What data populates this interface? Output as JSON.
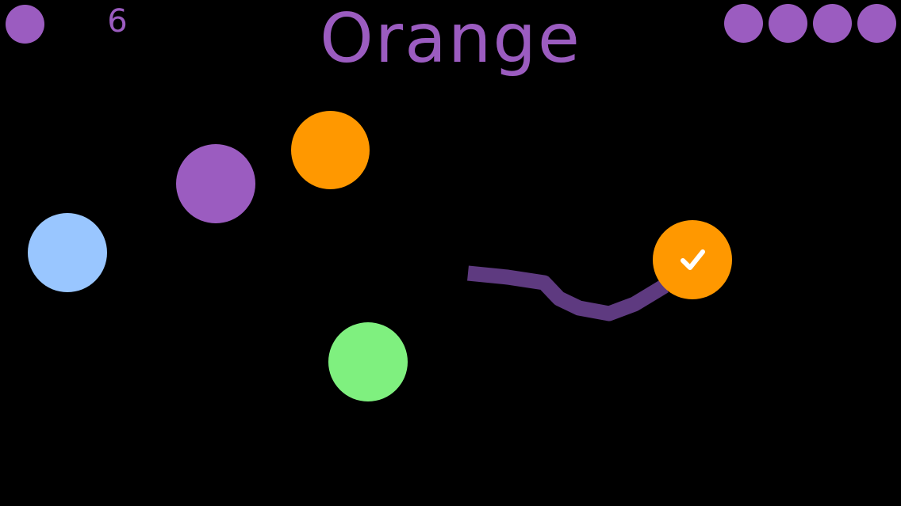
{
  "hud": {
    "score": "6",
    "target_word": "Orange",
    "lives_remaining": 4
  },
  "colors": {
    "background": "#000000",
    "hud": "#9b5cc0",
    "trail": "#5e3a80",
    "purple": "#9b5cc0",
    "orange": "#ff9800",
    "light_blue": "#99c6ff",
    "green": "#7ff07f",
    "check": "#ffffff"
  },
  "balls": [
    {
      "name": "ball-orange-top",
      "color": "orange"
    },
    {
      "name": "ball-purple",
      "color": "purple"
    },
    {
      "name": "ball-light-blue",
      "color": "light_blue"
    },
    {
      "name": "ball-green",
      "color": "green"
    },
    {
      "name": "ball-orange-selected",
      "color": "orange",
      "selected": true,
      "icon": "checkmark-icon"
    }
  ]
}
